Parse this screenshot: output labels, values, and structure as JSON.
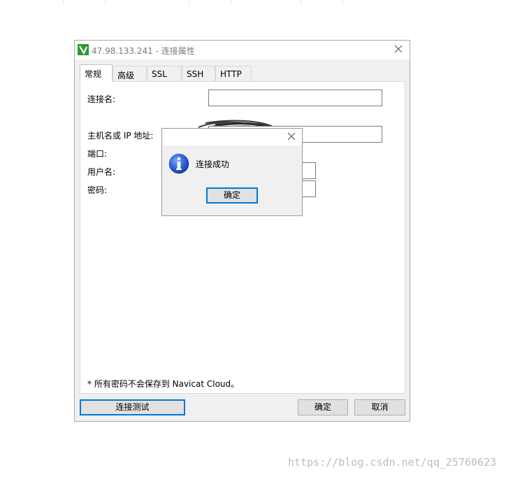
{
  "window": {
    "title": "47.98.133.241 - 连接属性",
    "icon": "navicat-icon"
  },
  "tabs": [
    {
      "label": "常规",
      "active": true
    },
    {
      "label": "高级",
      "active": false
    },
    {
      "label": "SSL",
      "active": false
    },
    {
      "label": "SSH",
      "active": false
    },
    {
      "label": "HTTP",
      "active": false
    }
  ],
  "form": {
    "connection_name_label": "连接名:",
    "connection_name_value": "",
    "host_label": "主机名或 IP 地址:",
    "host_value": "",
    "port_label": "端口:",
    "port_value": "",
    "username_label": "用户名:",
    "username_value": "",
    "password_label": "密码:",
    "password_value": ""
  },
  "note": "* 所有密码不会保存到 Navicat Cloud。",
  "buttons": {
    "test_connection": "连接测试",
    "ok": "确定",
    "cancel": "取消"
  },
  "message_box": {
    "text": "连接成功",
    "ok": "确定",
    "icon": "info-icon"
  },
  "watermark": "https://blog.csdn.net/qq_25760623",
  "colors": {
    "focus_border": "#0078d7",
    "dialog_bg": "#f0f0f0",
    "info_blue": "#1f55c6"
  }
}
